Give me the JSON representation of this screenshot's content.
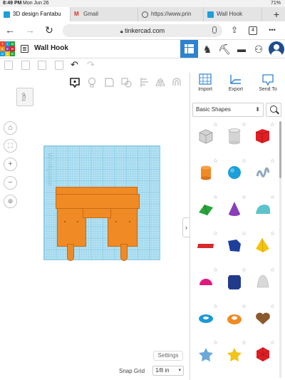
{
  "status_bar": {
    "time": "8:49 PM",
    "date": "Mon Jun 26",
    "battery": "71%"
  },
  "tabs": [
    {
      "label": "3D design Fantabu",
      "active": true,
      "icon": "tinkercad-favicon"
    },
    {
      "label": "Gmail",
      "active": false,
      "icon": "gmail-icon"
    },
    {
      "label": "https://www.prin",
      "active": false,
      "icon": "globe-icon"
    },
    {
      "label": "Wall Hook",
      "active": false,
      "icon": "tinkercad-favicon"
    }
  ],
  "browser": {
    "url": "tinkercad.com",
    "tab_count": "4",
    "new_tab": "+",
    "more": "•••"
  },
  "logo_letters": [
    "T",
    "I",
    "N",
    "K",
    "E",
    "R",
    "C",
    "A",
    "D"
  ],
  "project": {
    "title": "Wall Hook"
  },
  "panel_actions": {
    "import": "Import",
    "export": "Export",
    "send_to": "Send To"
  },
  "workspace": {
    "viewcube_face": "TOP",
    "workplane_label": "Workplane"
  },
  "shapes_panel": {
    "category": "Basic Shapes"
  },
  "footer": {
    "settings": "Settings",
    "snap_grid_label": "Snap Grid",
    "snap_grid_value": "1/8 in"
  },
  "shapes": [
    {
      "name": "box-hole",
      "color": "#bfbfbf"
    },
    {
      "name": "cylinder-hole",
      "color": "#c4c4c4"
    },
    {
      "name": "box",
      "color": "#e01f25"
    },
    {
      "name": "cylinder",
      "color": "#f08a24"
    },
    {
      "name": "sphere",
      "color": "#1d9fd9"
    },
    {
      "name": "scribble",
      "color": "#8fa6c0"
    },
    {
      "name": "roof",
      "color": "#29a33b"
    },
    {
      "name": "cone",
      "color": "#8a3fb8"
    },
    {
      "name": "round-roof",
      "color": "#5cc3cc"
    },
    {
      "name": "text",
      "color": "#d62a2a"
    },
    {
      "name": "polygon",
      "color": "#1d3f9c"
    },
    {
      "name": "pyramid",
      "color": "#f3c40f"
    },
    {
      "name": "half-sphere",
      "color": "#e0197d"
    },
    {
      "name": "hexagonal-prism",
      "color": "#223a8c"
    },
    {
      "name": "paraboloid",
      "color": "#d9d9d9"
    },
    {
      "name": "torus",
      "color": "#1a9ad6"
    },
    {
      "name": "tube",
      "color": "#f08a24"
    },
    {
      "name": "heart",
      "color": "#8a5a2c"
    },
    {
      "name": "star",
      "color": "#6aa8d8"
    },
    {
      "name": "star-gold",
      "color": "#f0c419"
    },
    {
      "name": "icosahedron",
      "color": "#e01f25"
    }
  ]
}
